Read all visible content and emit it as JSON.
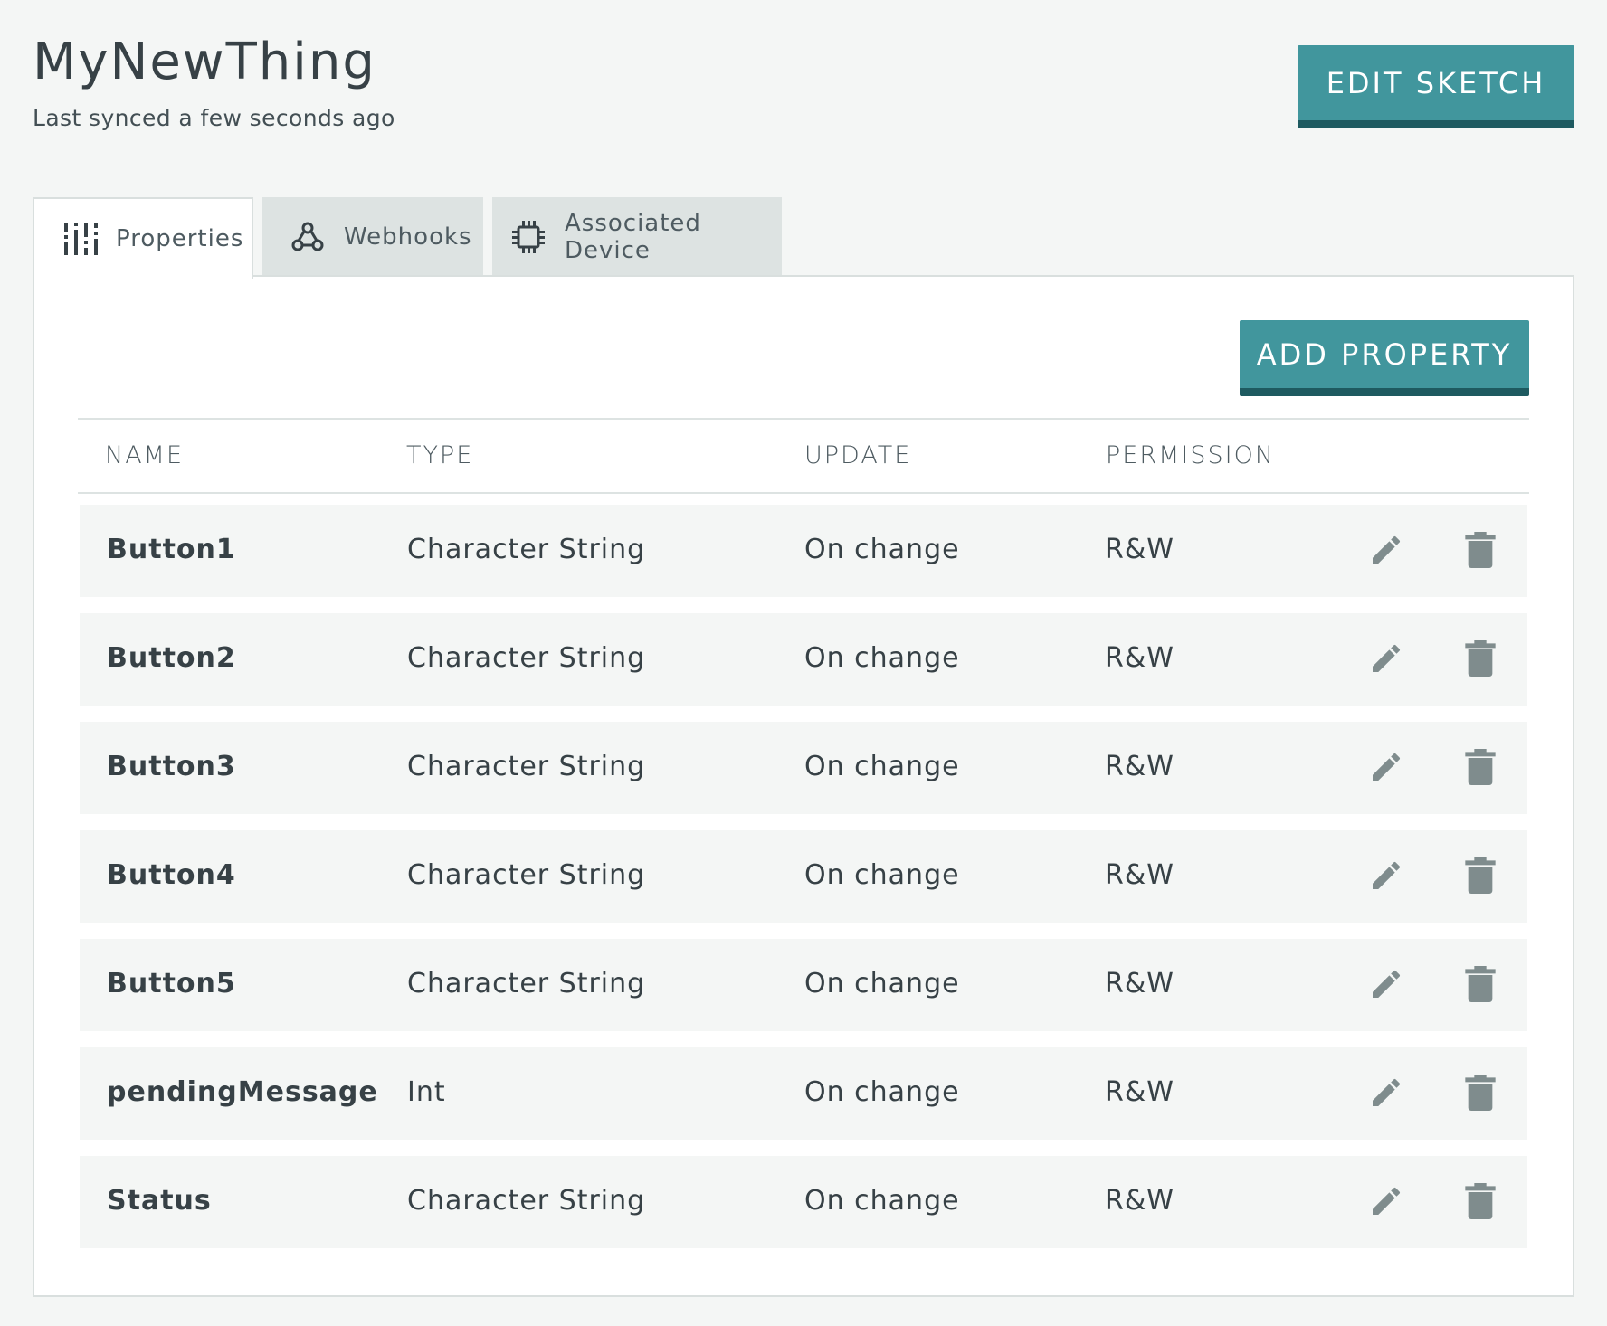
{
  "header": {
    "title": "MyNewThing",
    "subtitle": "Last synced a few seconds ago",
    "edit_sketch_label": "EDIT SKETCH"
  },
  "tabs": [
    {
      "label": "Properties",
      "icon": "sliders-icon",
      "active": true
    },
    {
      "label": "Webhooks",
      "icon": "webhook-icon",
      "active": false
    },
    {
      "label": "Associated Device",
      "icon": "chip-icon",
      "active": false
    }
  ],
  "panel": {
    "add_property_label": "ADD PROPERTY"
  },
  "table": {
    "headers": [
      "NAME",
      "TYPE",
      "UPDATE",
      "PERMISSION"
    ],
    "rows": [
      {
        "name": "Button1",
        "type": "Character String",
        "update": "On change",
        "permission": "R&W"
      },
      {
        "name": "Button2",
        "type": "Character String",
        "update": "On change",
        "permission": "R&W"
      },
      {
        "name": "Button3",
        "type": "Character String",
        "update": "On change",
        "permission": "R&W"
      },
      {
        "name": "Button4",
        "type": "Character String",
        "update": "On change",
        "permission": "R&W"
      },
      {
        "name": "Button5",
        "type": "Character String",
        "update": "On change",
        "permission": "R&W"
      },
      {
        "name": "pendingMessage",
        "type": "Int",
        "update": "On change",
        "permission": "R&W"
      },
      {
        "name": "Status",
        "type": "Character String",
        "update": "On change",
        "permission": "R&W"
      }
    ]
  },
  "colors": {
    "accent": "#41969d",
    "accent_dark": "#1e5a60",
    "background": "#f4f6f5",
    "row_background": "#f4f6f5",
    "icon_gray": "#7f8c8d"
  }
}
